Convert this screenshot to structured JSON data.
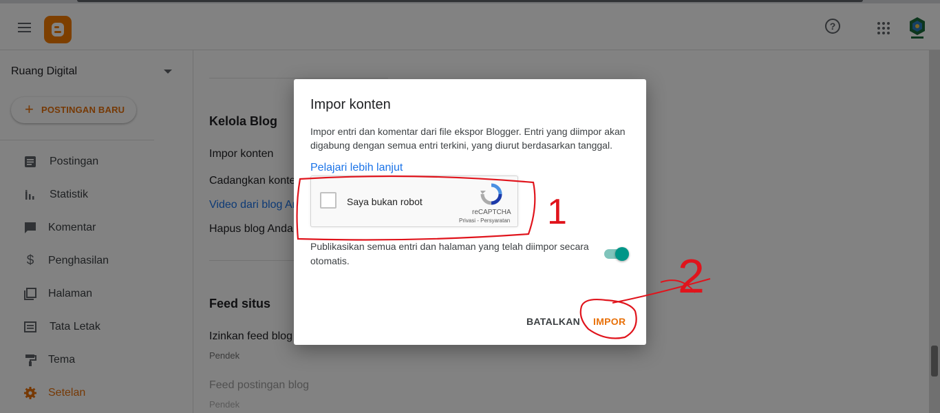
{
  "sidebar": {
    "blog_name": "Ruang Digital",
    "new_post_label": "POSTINGAN BARU",
    "items": [
      {
        "label": "Postingan",
        "icon": "article-icon"
      },
      {
        "label": "Statistik",
        "icon": "stats-icon"
      },
      {
        "label": "Komentar",
        "icon": "comment-icon"
      },
      {
        "label": "Penghasilan",
        "icon": "dollar-icon"
      },
      {
        "label": "Halaman",
        "icon": "pages-icon"
      },
      {
        "label": "Tata Letak",
        "icon": "layout-icon"
      },
      {
        "label": "Tema",
        "icon": "paint-roller-icon"
      },
      {
        "label": "Setelan",
        "icon": "gear-icon"
      }
    ]
  },
  "content": {
    "manage_heading": "Kelola Blog",
    "manage_items": [
      "Impor konten",
      "Cadangkan konten",
      "Video dari blog Anda",
      "Hapus blog Anda"
    ],
    "feed_heading": "Feed situs",
    "feed_items": [
      {
        "label": "Izinkan feed blog",
        "value": "Pendek"
      },
      {
        "label": "Feed postingan blog",
        "value": "Pendek"
      }
    ]
  },
  "dialog": {
    "title": "Impor konten",
    "description": "Impor entri dan komentar dari file ekspor Blogger. Entri yang diimpor akan digabung dengan semua entri terkini, yang diurut berdasarkan tanggal.",
    "learn_more": "Pelajari lebih lanjut",
    "captcha": {
      "label": "Saya bukan robot",
      "brand": "reCAPTCHA",
      "terms": "Privasi - Persyaratan"
    },
    "publish_text": "Publikasikan semua entri dan halaman yang telah diimpor secara otomatis.",
    "publish_toggle_on": true,
    "cancel_label": "BATALKAN",
    "import_label": "IMPOR"
  },
  "annotations": {
    "step1": "1",
    "step2": "2"
  },
  "colors": {
    "accent": "#e8710a",
    "link": "#1a73e8",
    "toggle": "#009688",
    "annotation": "#e0141c"
  }
}
